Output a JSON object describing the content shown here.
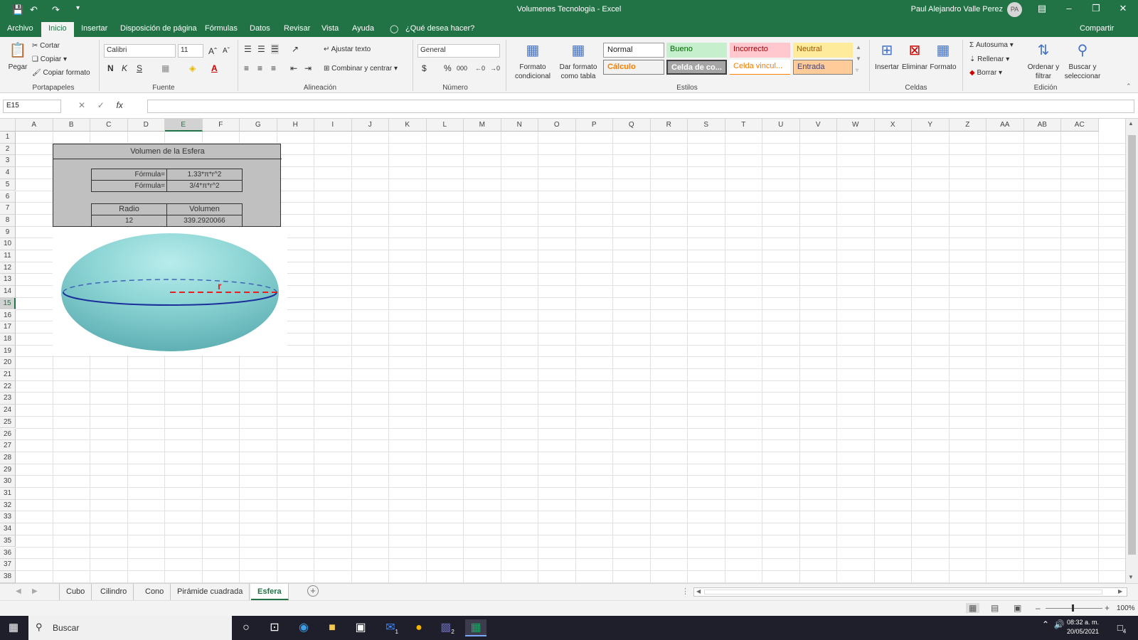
{
  "titlebar": {
    "title": "Volumenes Tecnologia  -  Excel",
    "user": "Paul Alejandro Valle Perez",
    "avatar": "PA"
  },
  "menu": {
    "tabs": [
      "Archivo",
      "Inicio",
      "Insertar",
      "Disposición de página",
      "Fórmulas",
      "Datos",
      "Revisar",
      "Vista",
      "Ayuda"
    ],
    "active": "Inicio",
    "tell_me": "¿Qué desea hacer?",
    "share": "Compartir"
  },
  "ribbon": {
    "clipboard": {
      "paste": "Pegar",
      "cut": "Cortar",
      "copy": "Copiar",
      "format_painter": "Copiar formato",
      "label": "Portapapeles"
    },
    "font": {
      "name": "Calibri",
      "size": "11",
      "bold": "N",
      "italic": "K",
      "underline": "S",
      "label": "Fuente"
    },
    "alignment": {
      "wrap": "Ajustar texto",
      "merge": "Combinar y centrar",
      "label": "Alineación"
    },
    "number": {
      "format": "General",
      "label": "Número"
    },
    "styles": {
      "cond_format": "Formato condicional",
      "table_format": "Dar formato como tabla",
      "cells": [
        "Normal",
        "Bueno",
        "Incorrecto",
        "Neutral",
        "Cálculo",
        "Celda de co...",
        "Celda vincul...",
        "Entrada"
      ],
      "label": "Estilos"
    },
    "cells": {
      "insert": "Insertar",
      "delete": "Eliminar",
      "format": "Formato",
      "label": "Celdas"
    },
    "editing": {
      "autosum": "Autosuma",
      "fill": "Rellenar",
      "clear": "Borrar",
      "sort": "Ordenar y filtrar",
      "find": "Buscar y seleccionar",
      "label": "Edición"
    }
  },
  "formula_bar": {
    "name_box": "E15",
    "fx": "fx",
    "value": ""
  },
  "columns": [
    "A",
    "B",
    "C",
    "D",
    "E",
    "F",
    "G",
    "H",
    "I",
    "J",
    "K",
    "L",
    "M",
    "N",
    "O",
    "P",
    "Q",
    "R",
    "S",
    "T",
    "U",
    "V",
    "W",
    "X",
    "Y",
    "Z",
    "AA",
    "AB",
    "AC"
  ],
  "selected_column": "E",
  "selected_row": 15,
  "row_count": 38,
  "sheet": {
    "title": "Volumen de la Esfera",
    "formula_label": "Fórmula=",
    "formula1": "1.33*π*r^2",
    "formula2": "3/4*π*r^2",
    "radio_header": "Radio",
    "volumen_header": "Volumen",
    "radio_value": "12",
    "volumen_value": "339.2920066",
    "radius_label": "r"
  },
  "sheet_tabs": [
    "Cubo",
    "Cilindro",
    "Cono",
    "Pirámide cuadrada",
    "Esfera"
  ],
  "active_sheet": "Esfera",
  "status": {
    "zoom": "100%"
  },
  "taskbar": {
    "search": "Buscar",
    "time": "08:32 a. m.",
    "date": "20/05/2021",
    "mail_badge": "1",
    "teams_badge": "2",
    "notif_badge": "4"
  }
}
